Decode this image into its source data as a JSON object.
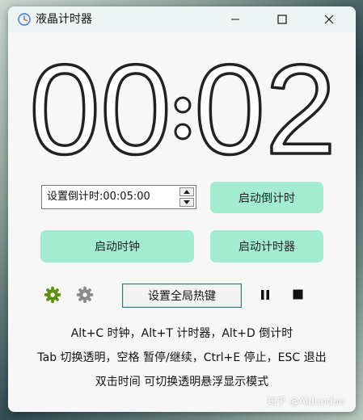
{
  "window": {
    "title": "液晶计时器",
    "controls": [
      "minimize-icon",
      "maximize-icon",
      "close-icon"
    ]
  },
  "display": {
    "time": "00:02",
    "minutes": "00",
    "separator": ":",
    "seconds": "02"
  },
  "countdown_setting": {
    "value": "设置倒计时:00:05:00"
  },
  "buttons": {
    "start_countdown": "启动倒计时",
    "start_clock": "启动时钟",
    "start_timer": "启动计时器",
    "set_hotkey": "设置全局热键"
  },
  "toolbar_icons": {
    "settings_green": "gear-icon",
    "settings_gray": "gear-icon",
    "pause": "pause-icon",
    "stop": "stop-icon"
  },
  "help": {
    "line1": "Alt+C 时钟，Alt+T 计时器，Alt+D 倒计时",
    "line2": "Tab 切换透明，空格 暂停/继续，Ctrl+E 停止，ESC 退出",
    "line3": "双击时间 可切换透明悬浮显示模式"
  },
  "watermark": "知乎 @Aiduoduo",
  "colors": {
    "button_green": "#a3ecd1",
    "gear_green": "#5e8f12",
    "gear_gray": "#8a8a8a",
    "digit_stroke": "#222222"
  }
}
